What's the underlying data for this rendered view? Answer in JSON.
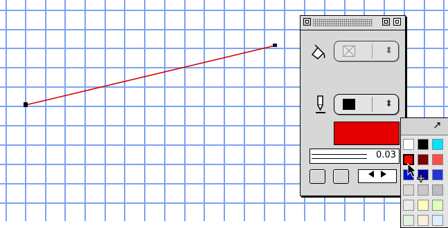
{
  "canvas": {
    "grid_color": "#7aa3f2",
    "line_color": "#d40000"
  },
  "style_palette": {
    "fill": {
      "value_icon": "none-swatch-icon",
      "arrows": "⬍"
    },
    "stroke": {
      "value_icon": "black-swatch",
      "arrows": "⬍"
    },
    "current_color": "#e40000",
    "line_weight": "0.03"
  },
  "color_popup": {
    "header_icon": "diagonal-arrow-icon",
    "swatches": [
      [
        "#ffffff",
        "#000000",
        "#00e5ff"
      ],
      [
        "#ff0000",
        "#7b0000",
        "#ff4d4d"
      ],
      [
        "#0010cc",
        "#0000a0",
        "#2233d8"
      ],
      [
        "#d8d8d8",
        "#c8c8c8",
        "#bcbcbc"
      ],
      [
        "#ececec",
        "#ffffbb",
        "#ddffbb"
      ],
      [
        "#e0f4e0",
        "#f8f0dc",
        "#dcefff"
      ]
    ],
    "selected": "#ff0000"
  }
}
